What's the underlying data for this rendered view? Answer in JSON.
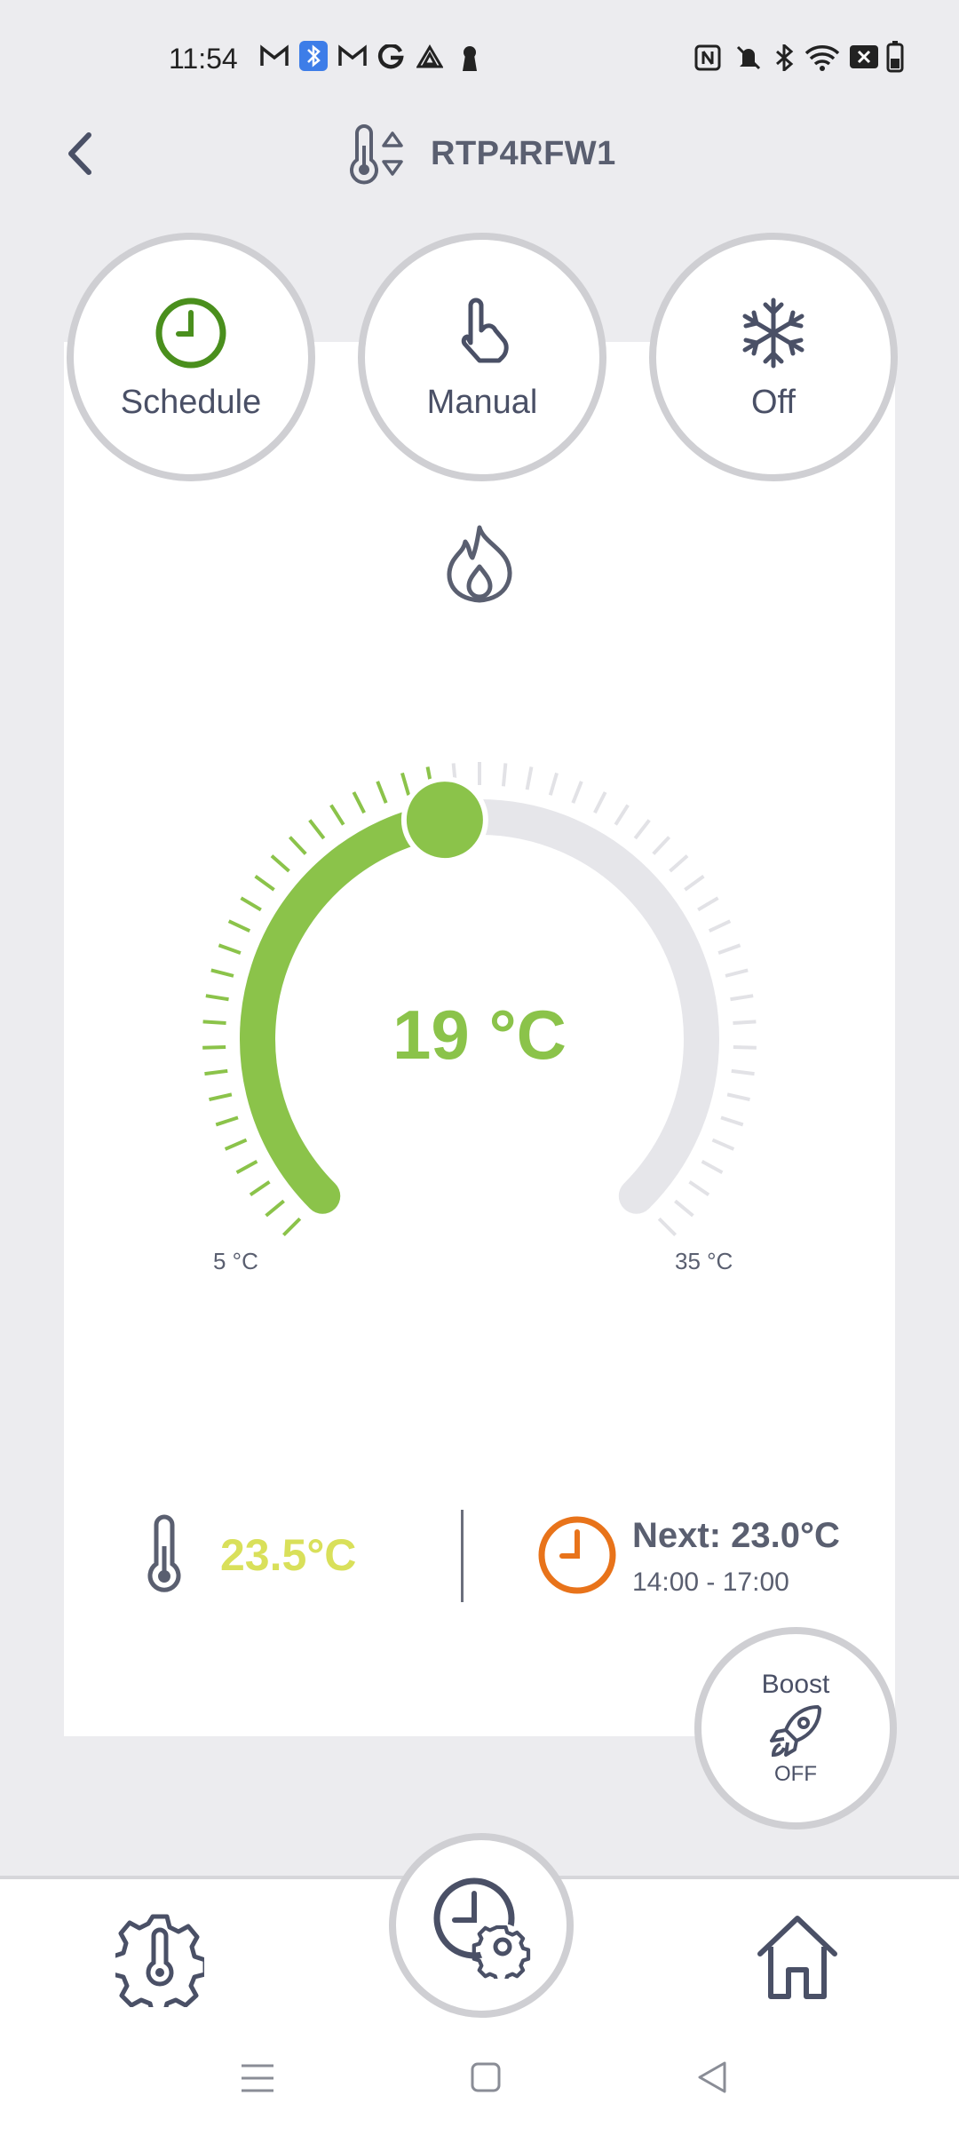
{
  "status_bar": {
    "time": "11:54",
    "left_icons": [
      "gmail-icon",
      "bluetooth-app-icon",
      "gmail-icon",
      "google-icon",
      "drive-icon",
      "keyhole-icon"
    ],
    "right_icons": [
      "nfc-icon",
      "mute-icon",
      "bluetooth-icon",
      "wifi-icon",
      "no-sim-icon",
      "battery-icon"
    ]
  },
  "header": {
    "device_name": "RTP4RFW1"
  },
  "modes": [
    {
      "label": "Schedule",
      "icon": "clock-icon",
      "color": "#4a8f1d",
      "active": true
    },
    {
      "label": "Manual",
      "icon": "hand-pointer-icon",
      "color": "#4a5066",
      "active": false
    },
    {
      "label": "Off",
      "icon": "snowflake-icon",
      "color": "#4a5066",
      "active": false
    }
  ],
  "dial": {
    "value_text": "19 °C",
    "setpoint": 19,
    "min": 5,
    "max": 35,
    "min_label": "5 °C",
    "max_label": "35 °C",
    "active_color": "#8bc34a",
    "inactive_color": "#e6e6ea"
  },
  "info": {
    "current_temp": "23.5°C",
    "current_temp_color": "#d9e05a",
    "next_label": "Next: 23.0°C",
    "next_time": "14:00 - 17:00",
    "next_icon_color": "#e8731a"
  },
  "boost": {
    "label": "Boost",
    "state": "OFF"
  },
  "bottom_nav": {
    "items": [
      "thermostat-settings-icon",
      "schedule-settings-icon",
      "home-icon"
    ]
  }
}
